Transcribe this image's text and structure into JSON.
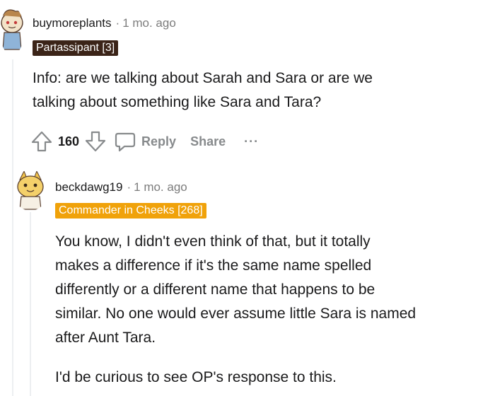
{
  "comments": [
    {
      "username": "buymoreplants",
      "separator": "·",
      "time": "1 mo. ago",
      "flair": "Partassipant [3]",
      "body": [
        "Info: are we talking about Sarah and Sara or are we",
        "talking about something like Sara and Tara?"
      ],
      "votes": "160",
      "reply_label": "Reply",
      "share_label": "Share",
      "more_label": "···"
    },
    {
      "username": "beckdawg19",
      "separator": "·",
      "time": "1 mo. ago",
      "flair": "Commander in Cheeks [268]",
      "body_paragraph_1": [
        "You know, I didn't even think of that, but it totally",
        "makes a difference if it's the same name spelled",
        "differently or a different name that happens to be",
        "similar. No one would ever assume little Sara is named",
        "after Aunt Tara."
      ],
      "body_paragraph_2": "I'd be curious to see OP's response to this."
    }
  ],
  "colors": {
    "text": "#1a1a1b",
    "meta": "#7c7c7c",
    "action": "#878a8c",
    "flair_dark": "#3b2418",
    "flair_gold": "#f0a20a",
    "thread_line": "#edeff1"
  },
  "icons": {
    "upvote": "arrow-up-outline",
    "downvote": "arrow-down-outline",
    "reply": "speech-bubble-outline",
    "more": "three-dots"
  }
}
